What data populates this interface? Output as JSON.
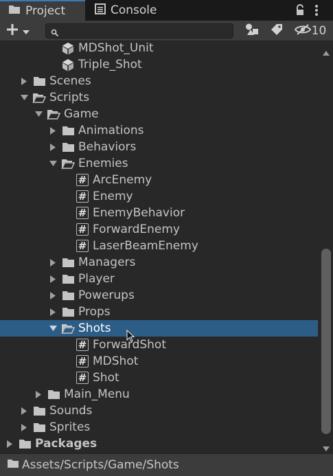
{
  "tabs": [
    {
      "label": "Project",
      "icon": "folder-icon",
      "active": true
    },
    {
      "label": "Console",
      "icon": "console-icon",
      "active": false
    }
  ],
  "toolbar": {
    "search_placeholder": "",
    "hidden_count": "10"
  },
  "tree": [
    {
      "label": "MDShot_Unit",
      "type": "prefab",
      "depth": 3,
      "arrow": "none"
    },
    {
      "label": "Triple_Shot",
      "type": "prefab",
      "depth": 3,
      "arrow": "none"
    },
    {
      "label": "Scenes",
      "type": "folder",
      "depth": 1,
      "arrow": "collapsed"
    },
    {
      "label": "Scripts",
      "type": "folder-open",
      "depth": 1,
      "arrow": "expanded"
    },
    {
      "label": "Game",
      "type": "folder-open",
      "depth": 2,
      "arrow": "expanded"
    },
    {
      "label": "Animations",
      "type": "folder",
      "depth": 3,
      "arrow": "collapsed"
    },
    {
      "label": "Behaviors",
      "type": "folder",
      "depth": 3,
      "arrow": "collapsed"
    },
    {
      "label": "Enemies",
      "type": "folder-open",
      "depth": 3,
      "arrow": "expanded"
    },
    {
      "label": "ArcEnemy",
      "type": "script",
      "depth": 4,
      "arrow": "none"
    },
    {
      "label": "Enemy",
      "type": "script",
      "depth": 4,
      "arrow": "none"
    },
    {
      "label": "EnemyBehavior",
      "type": "script",
      "depth": 4,
      "arrow": "none"
    },
    {
      "label": "ForwardEnemy",
      "type": "script",
      "depth": 4,
      "arrow": "none"
    },
    {
      "label": "LaserBeamEnemy",
      "type": "script",
      "depth": 4,
      "arrow": "none"
    },
    {
      "label": "Managers",
      "type": "folder",
      "depth": 3,
      "arrow": "collapsed"
    },
    {
      "label": "Player",
      "type": "folder",
      "depth": 3,
      "arrow": "collapsed"
    },
    {
      "label": "Powerups",
      "type": "folder",
      "depth": 3,
      "arrow": "collapsed"
    },
    {
      "label": "Props",
      "type": "folder",
      "depth": 3,
      "arrow": "collapsed"
    },
    {
      "label": "Shots",
      "type": "folder-open",
      "depth": 3,
      "arrow": "expanded",
      "selected": true
    },
    {
      "label": "ForwardShot",
      "type": "script",
      "depth": 4,
      "arrow": "none"
    },
    {
      "label": "MDShot",
      "type": "script",
      "depth": 4,
      "arrow": "none"
    },
    {
      "label": "Shot",
      "type": "script",
      "depth": 4,
      "arrow": "none"
    },
    {
      "label": "Main_Menu",
      "type": "folder",
      "depth": 2,
      "arrow": "collapsed"
    },
    {
      "label": "Sounds",
      "type": "folder",
      "depth": 1,
      "arrow": "collapsed"
    },
    {
      "label": "Sprites",
      "type": "folder",
      "depth": 1,
      "arrow": "collapsed"
    },
    {
      "label": "Packages",
      "type": "folder",
      "depth": 0,
      "arrow": "collapsed",
      "bold": true
    }
  ],
  "status": {
    "path": "Assets/Scripts/Game/Shots"
  },
  "colors": {
    "selection": "#2c5d87",
    "background": "#282828",
    "toolbar": "#3c3c3c",
    "tab_accent": "#3a79bb"
  }
}
